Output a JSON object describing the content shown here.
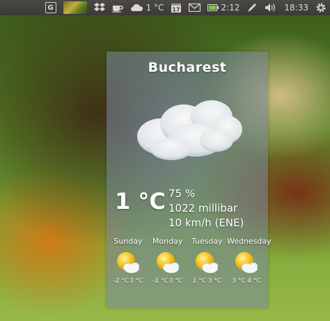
{
  "panel": {
    "app_icon_letter": "G",
    "weather_temp": "1 °C",
    "calendar_day": "17",
    "battery_time": "2:12",
    "clock": "18:33",
    "icons": [
      "g-app-icon",
      "photo-thumbnail",
      "dropbox-icon",
      "coffee-cup-icon",
      "cloud-weather-icon",
      "calendar-icon",
      "mail-icon",
      "battery-icon",
      "pen-icon",
      "volume-icon",
      "settings-gear-icon"
    ]
  },
  "weather": {
    "city": "Bucharest",
    "condition_icon": "overcast-cloud-icon",
    "temperature": "1 °C",
    "humidity": "75 %",
    "pressure": "1022 millibar",
    "wind": "10 km/h (ENE)",
    "forecast": [
      {
        "day": "Sunday",
        "low": "-2 °C",
        "high": "3 °C",
        "icon": "sun-cloud-icon"
      },
      {
        "day": "Monday",
        "low": "-1 °C",
        "high": "3 °C",
        "icon": "sun-cloud-icon"
      },
      {
        "day": "Tuesday",
        "low": "1 °C",
        "high": "3 °C",
        "icon": "sun-cloud-icon"
      },
      {
        "day": "Wednesday",
        "low": "3 °C",
        "high": "4 °C",
        "icon": "sun-cloud-icon"
      }
    ]
  }
}
